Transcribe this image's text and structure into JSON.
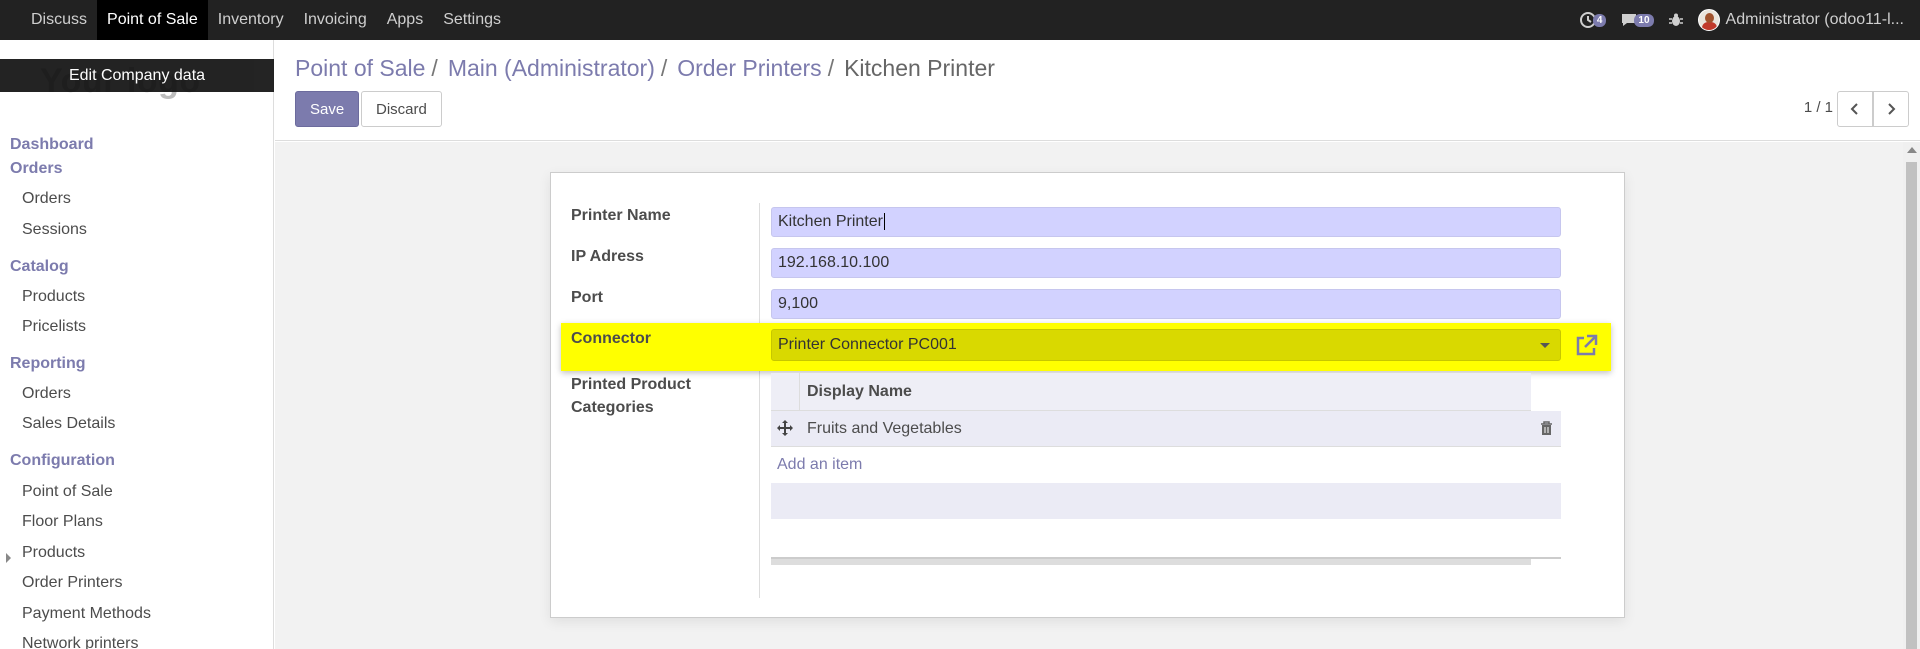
{
  "navbar": {
    "items": [
      "Discuss",
      "Point of Sale",
      "Inventory",
      "Invoicing",
      "Apps",
      "Settings"
    ],
    "active_index": 1,
    "activity_badge": "4",
    "messages_badge": "10",
    "user_label": "Administrator (odoo11-l..."
  },
  "sidebar": {
    "logo_text": "Your logo",
    "edit_company_label": "Edit Company data",
    "dashboard": "Dashboard",
    "orders_section": "Orders",
    "orders_items": [
      "Orders",
      "Sessions"
    ],
    "catalog_section": "Catalog",
    "catalog_items": [
      "Products",
      "Pricelists"
    ],
    "reporting_section": "Reporting",
    "reporting_items": [
      "Orders",
      "Sales Details"
    ],
    "configuration_section": "Configuration",
    "configuration_items": [
      "Point of Sale",
      "Floor Plans",
      "Products",
      "Order Printers",
      "Payment Methods",
      "Network printers"
    ]
  },
  "breadcrumb": {
    "links": [
      "Point of Sale",
      "Main (Administrator)",
      "Order Printers"
    ],
    "separator": "/",
    "current": "Kitchen Printer"
  },
  "actions": {
    "save_label": "Save",
    "discard_label": "Discard"
  },
  "pager": {
    "value": "1 / 1"
  },
  "form": {
    "printer_name_label": "Printer Name",
    "printer_name_value": "Kitchen Printer",
    "ip_label": "IP Adress",
    "ip_value": "192.168.10.100",
    "port_label": "Port",
    "port_value": "9,100",
    "connector_label": "Connector",
    "connector_value": "Printer Connector PC001",
    "categories_label_line1": "Printed Product",
    "categories_label_line2": "Categories",
    "categories_header": "Display Name",
    "categories_rows": [
      "Fruits and Vegetables"
    ],
    "add_item_label": "Add an item"
  },
  "colors": {
    "accent": "#7c7bad",
    "navbar_bg": "#222222",
    "highlight": "#ffff00",
    "input_bg": "#d2d2ff"
  },
  "icons": {
    "activity": "clock-icon",
    "messages": "chat-icon",
    "debug": "bug-icon",
    "external": "external-link-icon",
    "drag": "move-handle-icon",
    "delete": "trash-icon"
  }
}
